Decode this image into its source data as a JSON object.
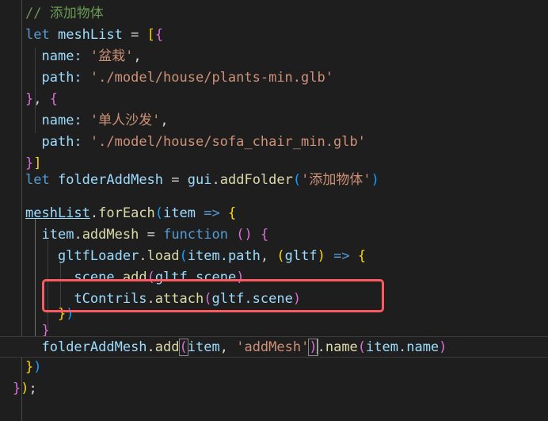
{
  "editor": {
    "name": "code-editor",
    "theme": "dark-plus",
    "background": "#1e1e1e",
    "font_size_px": 17,
    "line_height_px": 27,
    "colors": {
      "comment": "#6a9955",
      "keyword": "#569cd6",
      "variable": "#9cdcfe",
      "function": "#dcdcaa",
      "string": "#ce9178",
      "bracket_level_1": "#ffd700",
      "bracket_level_2": "#da70d6",
      "bracket_level_3": "#179fff",
      "punctuation": "#d4d4d4",
      "annotation_red": "#fb5a60",
      "current_line_bg": "#1f1f1f",
      "indent_guide": "#404040",
      "indent_guide_active": "#707070",
      "caret": "#aeafad"
    }
  },
  "lines": {
    "l1": {
      "comment": "// 添加物体"
    },
    "l2": {
      "kw_let": "let",
      "var_meshlist": "meshList",
      "op_eq": "=",
      "br_open_sq": "[",
      "br_open_cur": "{"
    },
    "l3": {
      "key_name": "name:",
      "str_value": "'盆栽'",
      "comma": ","
    },
    "l4": {
      "key_path": "path:",
      "str_value": "'./model/house/plants-min.glb'"
    },
    "l5": {
      "br_close_cur": "}",
      "comma": ",",
      "br_open_cur": "{"
    },
    "l6": {
      "key_name": "name:",
      "str_value": "'单人沙发'",
      "comma": ","
    },
    "l7": {
      "key_path": "path:",
      "str_value": "'./model/house/sofa_chair_min.glb'"
    },
    "l8": {
      "br_close_cur": "}",
      "br_close_sq": "]"
    },
    "l10": {
      "kw_let": "let",
      "var_folder": "folderAddMesh",
      "op_eq": "=",
      "obj_gui": "gui",
      "dot": ".",
      "fn_addfolder": "addFolder",
      "paren_open": "(",
      "str_arg": "'添加物体'",
      "paren_close": ")"
    },
    "l12": {
      "var_meshlist": "meshList",
      "dot": ".",
      "fn_foreach": "forEach",
      "paren_open": "(",
      "param_item": "item",
      "arrow": "=>",
      "br_open_cur": "{"
    },
    "l13": {
      "obj_item": "item",
      "dot": ".",
      "prop_addmesh": "addMesh",
      "op_eq": "=",
      "kw_function": "function",
      "parens": "()",
      "br_open_cur": "{"
    },
    "l14": {
      "obj_loader": "gltfLoader",
      "dot": ".",
      "fn_load": "load",
      "paren_open": "(",
      "arg_itempath": "item.path",
      "comma": ",",
      "paren2_open": "(",
      "param_gltf": "gltf",
      "paren2_close": ")",
      "arrow": "=>",
      "br_open_cur": "{"
    },
    "l15": {
      "obj_scene": "scene",
      "dot": ".",
      "fn_add": "add",
      "paren_open": "(",
      "arg_gltfscene": "gltf.scene",
      "paren_close": ")"
    },
    "l16": {
      "obj_tcontrils": "tContrils",
      "dot": ".",
      "fn_attach": "attach",
      "paren_open": "(",
      "arg_gltfscene": "gltf.scene",
      "paren_close": ")"
    },
    "l17": {
      "br_close_cur": "}",
      "paren_close": ")"
    },
    "l18": {
      "br_close_cur": "}"
    },
    "l19": {
      "obj_folder": "folderAddMesh",
      "dot": ".",
      "fn_add": "add",
      "paren_open": "(",
      "arg_item": "item",
      "comma": ",",
      "str_addmesh": "'addMesh'",
      "paren_close": ")",
      "dot2": ".",
      "fn_name": "name",
      "paren2_open": "(",
      "arg_itemname": "item.name",
      "paren2_close": ")"
    },
    "l20": {
      "br_close_cur": "}",
      "paren_close": ")"
    },
    "l21": {
      "br_close_cur": "}",
      "paren_close": ")",
      "semicolon": ";"
    }
  },
  "annotation": {
    "label": "red-highlight-rectangle",
    "color": "#fb5a60",
    "covers_lines": "tContrils.attach(gltf.scene) and })"
  }
}
